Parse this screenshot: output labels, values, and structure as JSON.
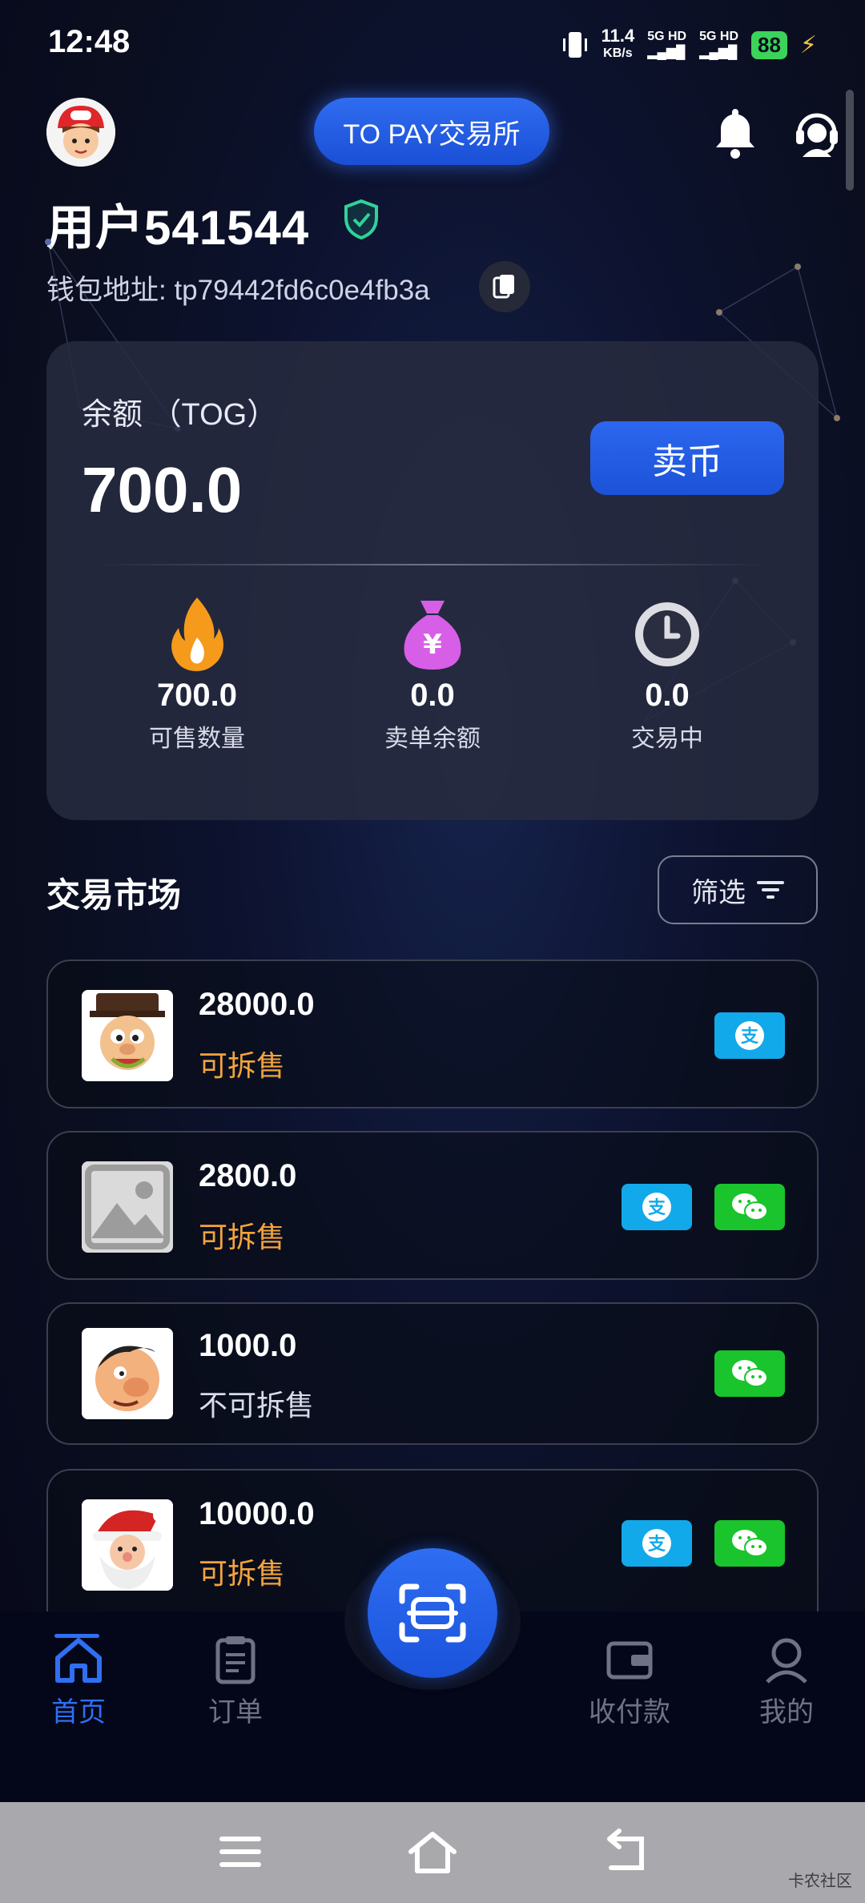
{
  "status_bar": {
    "time": "12:48",
    "net_speed": "11.4",
    "net_unit": "KB/s",
    "sim1": "5G HD",
    "sim2": "5G HD",
    "battery": "88"
  },
  "header": {
    "exchange_label": "TO PAY交易所",
    "username": "用户541544",
    "wallet_address": "钱包地址: tp79442fd6c0e4fb3a"
  },
  "balance": {
    "label": "余额 （TOG）",
    "value": "700.0",
    "sell_label": "卖币",
    "stats": [
      {
        "value": "700.0",
        "label": "可售数量",
        "icon": "fire-icon"
      },
      {
        "value": "0.0",
        "label": "卖单余额",
        "icon": "money-bag-icon"
      },
      {
        "value": "0.0",
        "label": "交易中",
        "icon": "clock-icon"
      }
    ]
  },
  "market": {
    "title": "交易市场",
    "filter_label": "筛选",
    "orders": [
      {
        "amount": "28000.0",
        "split": "可拆售",
        "split_color": "#f3a33c",
        "pay": [
          "alipay"
        ]
      },
      {
        "amount": "2800.0",
        "split": "可拆售",
        "split_color": "#f3a33c",
        "pay": [
          "alipay",
          "wechat"
        ]
      },
      {
        "amount": "1000.0",
        "split": "不可拆售",
        "split_color": "#d8dbe8",
        "pay": [
          "wechat"
        ]
      },
      {
        "amount": "10000.0",
        "split": "可拆售",
        "split_color": "#f3a33c",
        "pay": [
          "alipay",
          "wechat"
        ]
      }
    ]
  },
  "nav": {
    "home": "首页",
    "orders": "订单",
    "payments": "收付款",
    "mine": "我的"
  },
  "watermark": "卡农社区",
  "colors": {
    "accent": "#2f6ff2",
    "orange": "#f3a33c",
    "alipay": "#12a9ea",
    "wechat": "#19c42c"
  }
}
